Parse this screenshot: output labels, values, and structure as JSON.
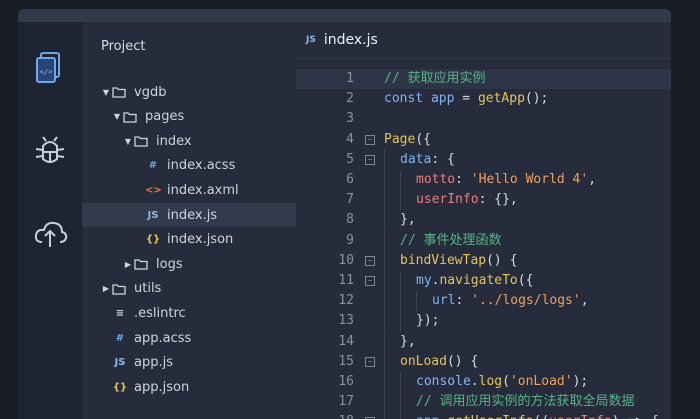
{
  "sidebar": {
    "title": "Project",
    "items": [
      {
        "label": "vgdb",
        "kind": "folder",
        "caret": "▼",
        "depth": 0,
        "selected": false
      },
      {
        "label": "pages",
        "kind": "folder",
        "caret": "▼",
        "depth": 1,
        "selected": false
      },
      {
        "label": "index",
        "kind": "folder",
        "caret": "▼",
        "depth": 2,
        "selected": false
      },
      {
        "label": "index.acss",
        "kind": "acss",
        "depth": 3,
        "selected": false
      },
      {
        "label": "index.axml",
        "kind": "axml",
        "depth": 3,
        "selected": false
      },
      {
        "label": "index.js",
        "kind": "js",
        "depth": 3,
        "selected": true
      },
      {
        "label": "index.json",
        "kind": "json",
        "depth": 3,
        "selected": false
      },
      {
        "label": "logs",
        "kind": "folder",
        "caret": "▶",
        "depth": 2,
        "selected": false
      },
      {
        "label": "utils",
        "kind": "folder",
        "caret": "▶",
        "depth": 0,
        "selected": false
      },
      {
        "label": ".eslintrc",
        "kind": "eslint",
        "depth": 0,
        "selected": false
      },
      {
        "label": "app.acss",
        "kind": "acss",
        "depth": 0,
        "selected": false
      },
      {
        "label": "app.js",
        "kind": "js",
        "depth": 0,
        "selected": false
      },
      {
        "label": "app.json",
        "kind": "json",
        "depth": 0,
        "selected": false
      }
    ]
  },
  "icons": {
    "acss": "#",
    "axml": "<>",
    "js": "JS",
    "json": "{}",
    "eslint": "≡"
  },
  "colors": {
    "acss": "#6ea8e8",
    "axml": "#e8794a",
    "js": "#8eb6e6",
    "json": "#e6c45a",
    "eslint": "#cfd4de"
  },
  "activity": [
    "file-code-icon",
    "bug-icon",
    "cloud-upload-icon"
  ],
  "editor": {
    "tab_icon": "JS",
    "tab_label": "index.js",
    "lines": [
      {
        "n": "1",
        "fold": "",
        "indent": 0,
        "cur": true,
        "tokens": [
          [
            "comment",
            "// 获取应用实例"
          ]
        ]
      },
      {
        "n": "2",
        "fold": "",
        "indent": 0,
        "tokens": [
          [
            "kw",
            "const "
          ],
          [
            "var",
            "app"
          ],
          [
            "punc",
            " = "
          ],
          [
            "fn",
            "getApp"
          ],
          [
            "punc",
            "();"
          ]
        ]
      },
      {
        "n": "3",
        "fold": "",
        "indent": 0,
        "tokens": []
      },
      {
        "n": "4",
        "fold": "−",
        "indent": 0,
        "tokens": [
          [
            "fn",
            "Page"
          ],
          [
            "punc",
            "({"
          ]
        ]
      },
      {
        "n": "5",
        "fold": "−",
        "indent": 1,
        "tokens": [
          [
            "kw",
            "data"
          ],
          [
            "punc",
            ": {"
          ]
        ]
      },
      {
        "n": "6",
        "fold": "",
        "indent": 2,
        "tokens": [
          [
            "prop",
            "motto"
          ],
          [
            "punc",
            ": "
          ],
          [
            "str",
            "'Hello World 4'"
          ],
          [
            "punc",
            ","
          ]
        ]
      },
      {
        "n": "7",
        "fold": "",
        "indent": 2,
        "tokens": [
          [
            "prop",
            "userInfo"
          ],
          [
            "punc",
            ": {},"
          ]
        ]
      },
      {
        "n": "8",
        "fold": "",
        "indent": 1,
        "tokens": [
          [
            "punc",
            "},"
          ]
        ]
      },
      {
        "n": "9",
        "fold": "",
        "indent": 1,
        "tokens": [
          [
            "comment",
            "// 事件处理函数"
          ]
        ]
      },
      {
        "n": "10",
        "fold": "−",
        "indent": 1,
        "tokens": [
          [
            "fn",
            "bindViewTap"
          ],
          [
            "punc",
            "() {"
          ]
        ]
      },
      {
        "n": "11",
        "fold": "−",
        "indent": 2,
        "tokens": [
          [
            "var",
            "my"
          ],
          [
            "punc",
            "."
          ],
          [
            "fn",
            "navigateTo"
          ],
          [
            "punc",
            "({"
          ]
        ]
      },
      {
        "n": "12",
        "fold": "",
        "indent": 3,
        "tokens": [
          [
            "kw",
            "url"
          ],
          [
            "punc",
            ": "
          ],
          [
            "str",
            "'../logs/logs'"
          ],
          [
            "punc",
            ","
          ]
        ]
      },
      {
        "n": "13",
        "fold": "",
        "indent": 2,
        "tokens": [
          [
            "punc",
            "});"
          ]
        ]
      },
      {
        "n": "14",
        "fold": "",
        "indent": 1,
        "tokens": [
          [
            "punc",
            "},"
          ]
        ]
      },
      {
        "n": "15",
        "fold": "−",
        "indent": 1,
        "tokens": [
          [
            "fn",
            "onLoad"
          ],
          [
            "punc",
            "() {"
          ]
        ]
      },
      {
        "n": "16",
        "fold": "",
        "indent": 2,
        "tokens": [
          [
            "var",
            "console"
          ],
          [
            "punc",
            "."
          ],
          [
            "fn",
            "log"
          ],
          [
            "punc",
            "("
          ],
          [
            "str",
            "'onLoad'"
          ],
          [
            "punc",
            ");"
          ]
        ]
      },
      {
        "n": "17",
        "fold": "",
        "indent": 2,
        "tokens": [
          [
            "comment",
            "// 调用应用实例的方法获取全局数据"
          ]
        ]
      },
      {
        "n": "18",
        "fold": "−",
        "indent": 2,
        "tokens": [
          [
            "var",
            "app"
          ],
          [
            "punc",
            "."
          ],
          [
            "fn",
            "getUserInfo"
          ],
          [
            "punc",
            "(("
          ],
          [
            "prop",
            "userInfo"
          ],
          [
            "punc",
            ") => {"
          ]
        ]
      }
    ]
  }
}
